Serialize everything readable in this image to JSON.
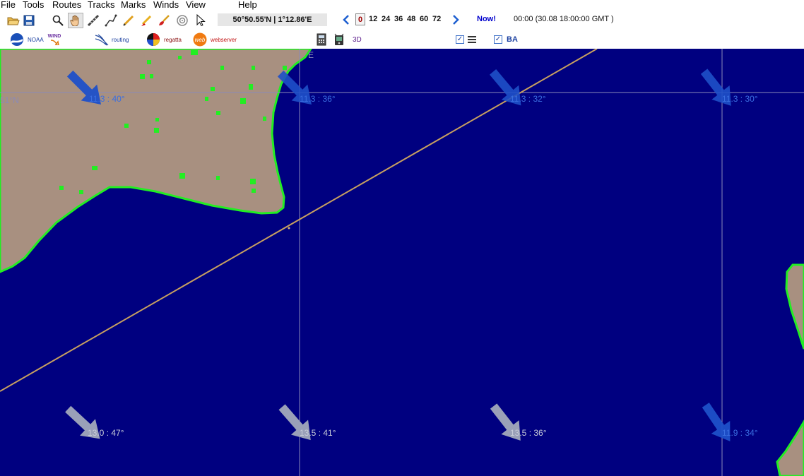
{
  "menu": {
    "file": "File",
    "tools": "Tools",
    "routes": "Routes",
    "tracks": "Tracks",
    "marks": "Marks",
    "winds": "Winds",
    "view": "View",
    "help": "Help"
  },
  "coordinates": "50°50.55'N | 1°12.86'E",
  "time_steps": {
    "current": "0",
    "steps": [
      "12",
      "24",
      "36",
      "48",
      "60",
      "72"
    ]
  },
  "now_label": "Now!",
  "datetime": "00:00 (30.08 18:00:00 GMT )",
  "row2": {
    "noaa": "NOAA",
    "wind": "WIND",
    "routing": "routing",
    "regatta": "regatta",
    "web": "web",
    "webserver": "webserver",
    "threed": "3D",
    "ba": "BA"
  },
  "map": {
    "lat_label": "51°N",
    "lon_label": "E",
    "wind_labels": [
      "11.3 : 40°",
      "11.3 : 36°",
      "11.3 : 32°",
      "11.3 : 30°",
      "13.0 : 47°",
      "13.5 : 41°",
      "13.5 : 36°",
      "11.9 : 34°"
    ]
  },
  "colors": {
    "sea": "#000080",
    "land": "#a89080",
    "coast": "#22ee22",
    "grid": "#8a8ab8",
    "route": "#c8a060",
    "arrow_blue": "#1e50c8",
    "arrow_grey": "#9aa0b8"
  }
}
